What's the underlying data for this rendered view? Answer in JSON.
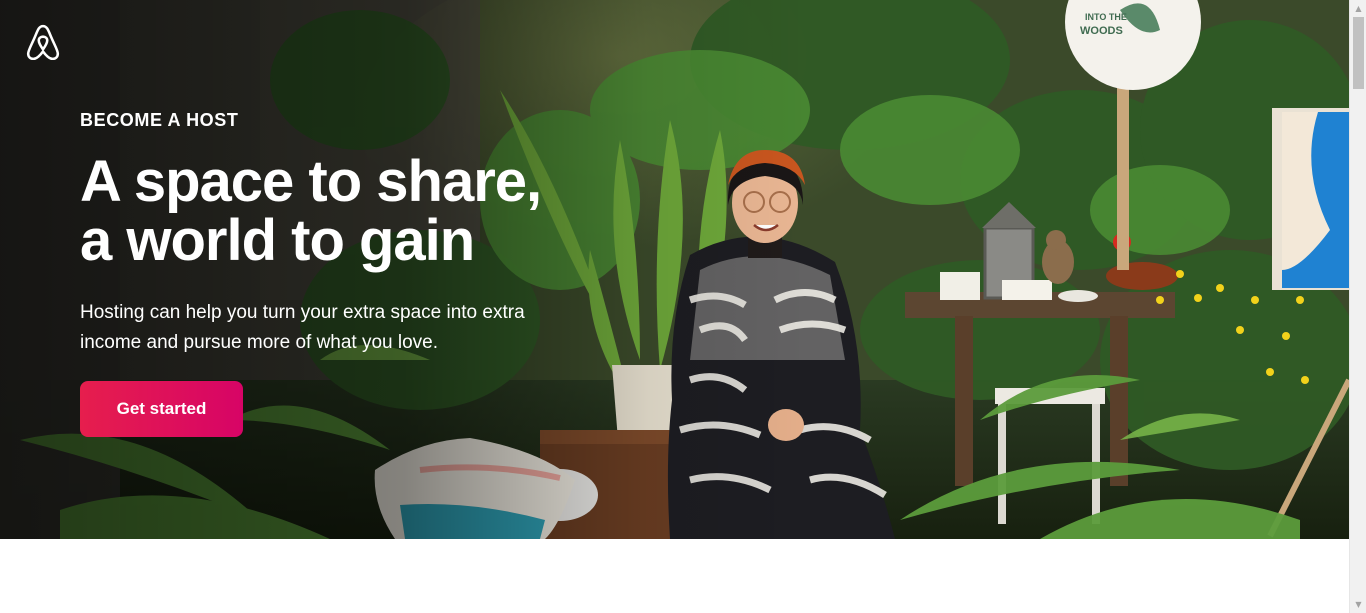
{
  "hero": {
    "eyebrow": "BECOME A HOST",
    "headline_line1": "A space to share,",
    "headline_line2": "a world to gain",
    "subtext": "Hosting can help you turn your extra space into extra income and pursue more of what you love.",
    "cta_label": "Get started",
    "cta_colors": [
      "#e61e4d",
      "#d70466"
    ]
  },
  "sign": {
    "text_line1": "INTO THE",
    "text_line2": "WOODS"
  },
  "icons": {
    "logo": "airbnb-logo-icon",
    "scroll_up": "scroll-up-arrow-icon",
    "scroll_down": "scroll-down-arrow-icon"
  }
}
